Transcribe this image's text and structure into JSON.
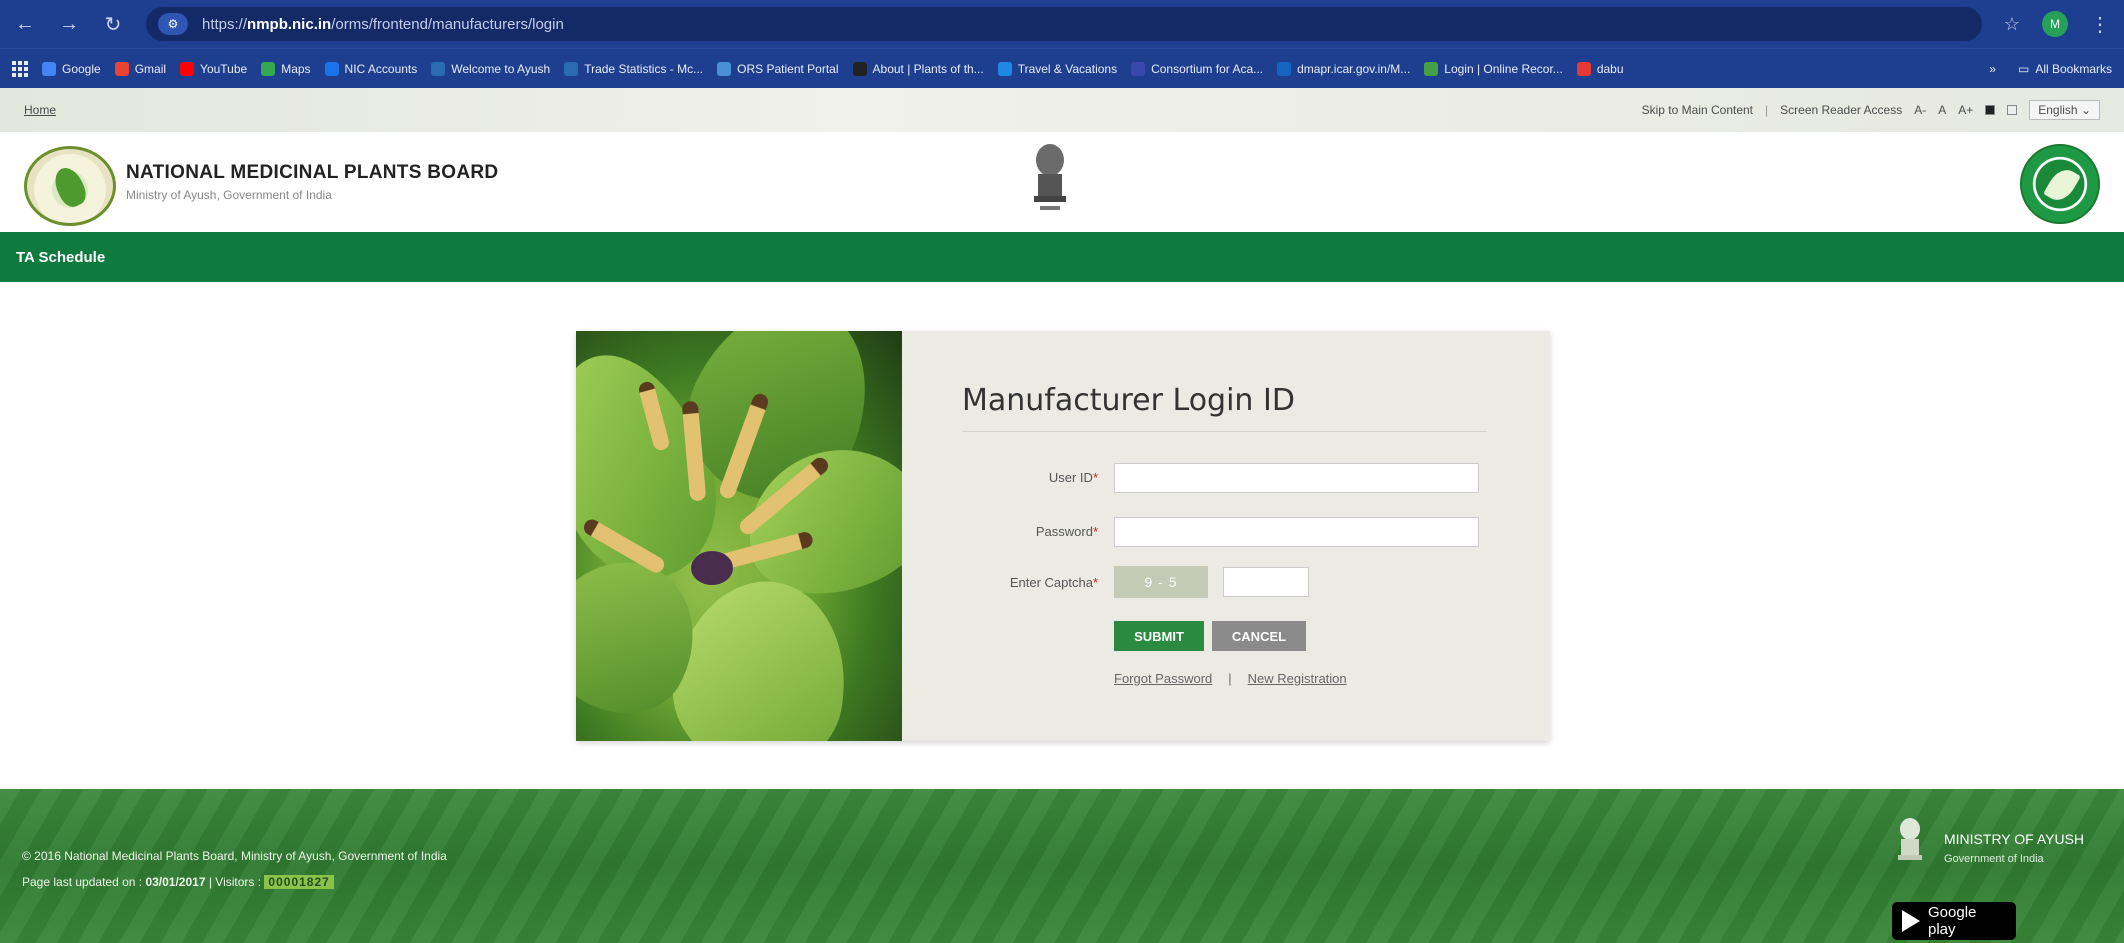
{
  "browser": {
    "url_prefix": "https://",
    "url_host": "nmpb.nic.in",
    "url_path": "/orms/frontend/manufacturers/login",
    "avatar_initial": "M",
    "bookmarks": [
      {
        "label": "Google",
        "color": "#4285f4"
      },
      {
        "label": "Gmail",
        "color": "#ea4335"
      },
      {
        "label": "YouTube",
        "color": "#ff0000"
      },
      {
        "label": "Maps",
        "color": "#34a853"
      },
      {
        "label": "NIC Accounts",
        "color": "#1a73e8"
      },
      {
        "label": "Welcome to Ayush",
        "color": "#2b6cb0"
      },
      {
        "label": "Trade Statistics - Mc...",
        "color": "#2b6cb0"
      },
      {
        "label": "ORS Patient Portal",
        "color": "#4a90d9"
      },
      {
        "label": "About | Plants of th...",
        "color": "#222222"
      },
      {
        "label": "Travel & Vacations",
        "color": "#1e88e5"
      },
      {
        "label": "Consortium for Aca...",
        "color": "#3949ab"
      },
      {
        "label": "dmapr.icar.gov.in/M...",
        "color": "#1565c0"
      },
      {
        "label": "Login | Online Recor...",
        "color": "#43a047"
      },
      {
        "label": "dabu",
        "color": "#e53935"
      }
    ],
    "more_label": "»",
    "all_bookmarks": "All Bookmarks"
  },
  "site": {
    "home": "Home",
    "skip_link": "Skip to Main Content",
    "screen_reader": "Screen Reader Access",
    "font_small": "A-",
    "font_normal": "A",
    "font_large": "A+",
    "language": "English",
    "org_name": "NATIONAL MEDICINAL PLANTS BOARD",
    "org_sub": "Ministry of Ayush, Government of India",
    "nav_item": "TA Schedule"
  },
  "login": {
    "title": "Manufacturer Login ID",
    "user_label": "User ID",
    "password_label": "Password",
    "captcha_label": "Enter Captcha",
    "required_mark": "*",
    "captcha_text": "9 - 5",
    "submit": "SUBMIT",
    "cancel": "CANCEL",
    "forgot": "Forgot Password",
    "separator": "|",
    "register": "New Registration"
  },
  "footer": {
    "copyright": "© 2016 National Medicinal Plants Board, Ministry of Ayush, Government of India",
    "updated_prefix": "Page last updated on : ",
    "updated_date": "03/01/2017",
    "visitors_label": " | Visitors : ",
    "visitors_count": "00001827",
    "ministry": "MINISTRY OF AYUSH",
    "ministry_sub": "Government of India",
    "store": "Google play"
  }
}
